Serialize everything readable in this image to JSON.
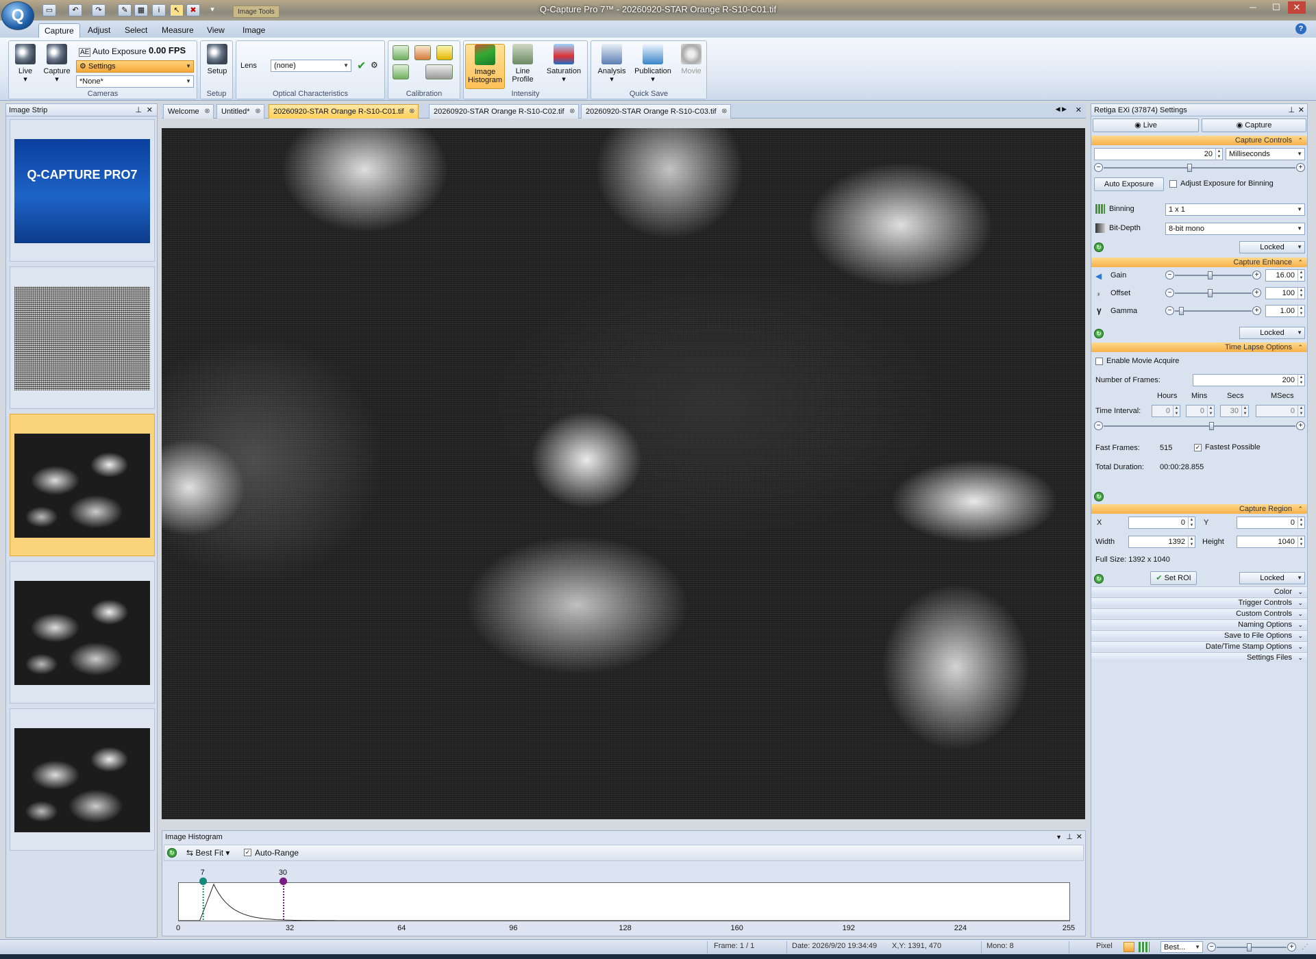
{
  "window": {
    "title": "Q-Capture Pro 7™ - 20260920-STAR Orange R-S10-C01.tif",
    "context_tab": "Image Tools",
    "orb": "Q"
  },
  "ribbon_tabs": [
    "Capture",
    "Adjust",
    "Select",
    "Measure",
    "View",
    "Image"
  ],
  "cameras": {
    "live": "Live",
    "capture": "Capture",
    "auto_exposure": "Auto Exposure",
    "fps": "0.00 FPS",
    "settings": "Settings",
    "preset": "*None*",
    "group": "Cameras"
  },
  "setup": {
    "label": "Setup",
    "group": "Setup"
  },
  "optical": {
    "lens_label": "Lens",
    "lens_value": "(none)",
    "group": "Optical Characteristics"
  },
  "calibration": {
    "group": "Calibration"
  },
  "intensity": {
    "histogram": "Image Histogram",
    "line_profile": "Line Profile",
    "saturation": "Saturation",
    "group": "Intensity"
  },
  "quicksave": {
    "analysis": "Analysis",
    "publication": "Publication",
    "movie": "Movie",
    "group": "Quick Save"
  },
  "image_strip": {
    "title": "Image Strip",
    "logo_text": "Q-CAPTURE PRO7"
  },
  "doc_tabs": [
    "Welcome",
    "Untitled*",
    "20260920-STAR Orange R-S10-C01.tif",
    "20260920-STAR Orange R-S10-C02.tif",
    "20260920-STAR Orange R-S10-C03.tif"
  ],
  "histogram": {
    "title": "Image Histogram",
    "fit": "Best Fit",
    "auto_range": "Auto-Range",
    "low_marker": "7",
    "high_marker": "30",
    "low_value": 7,
    "high_value": 30,
    "axis": [
      "0",
      "32",
      "64",
      "96",
      "128",
      "160",
      "192",
      "224",
      "255"
    ],
    "peak_value": 10
  },
  "settings": {
    "title": "Retiga EXi (37874) Settings",
    "live_btn": "Live",
    "capture_btn": "Capture",
    "capture_controls": "Capture Controls",
    "exposure": "20",
    "exposure_unit": "Milliseconds",
    "auto_exposure_btn": "Auto Exposure",
    "adjust_binning": "Adjust Exposure for Binning",
    "binning_label": "Binning",
    "binning_value": "1 x 1",
    "bitdepth_label": "Bit-Depth",
    "bitdepth_value": "8-bit mono",
    "locked": "Locked",
    "capture_enhance": "Capture Enhance",
    "gain_label": "Gain",
    "gain_value": "16.00",
    "offset_label": "Offset",
    "offset_value": "100",
    "gamma_label": "Gamma",
    "gamma_value": "1.00",
    "time_lapse": "Time Lapse Options",
    "enable_movie": "Enable Movie Acquire",
    "num_frames_label": "Number of Frames:",
    "num_frames": "200",
    "hours": "Hours",
    "mins": "Mins",
    "secs": "Secs",
    "msecs": "MSecs",
    "time_interval": "Time Interval:",
    "h_val": "0",
    "m_val": "0",
    "s_val": "30",
    "ms_val": "0",
    "fast_frames_label": "Fast Frames:",
    "fast_frames": "515",
    "fastest_possible": "Fastest Possible",
    "total_duration_label": "Total Duration:",
    "total_duration": "00:00:28.855",
    "capture_region": "Capture Region",
    "x_label": "X",
    "x_val": "0",
    "y_label": "Y",
    "y_val": "0",
    "width_label": "Width",
    "width_val": "1392",
    "height_label": "Height",
    "height_val": "1040",
    "full_size": "Full Size: 1392 x 1040",
    "set_roi": "Set ROI",
    "collapsed": [
      "Color",
      "Trigger Controls",
      "Custom Controls",
      "Naming Options",
      "Save to File Options",
      "Date/Time Stamp Options",
      "Settings Files"
    ]
  },
  "status": {
    "frame": "Frame: 1 / 1",
    "date": "Date: 2026/9/20 19:34:49",
    "xy": "X,Y: 1391,  470",
    "mono": "Mono:   8",
    "pixel": "Pixel",
    "zoom": "Best..."
  }
}
